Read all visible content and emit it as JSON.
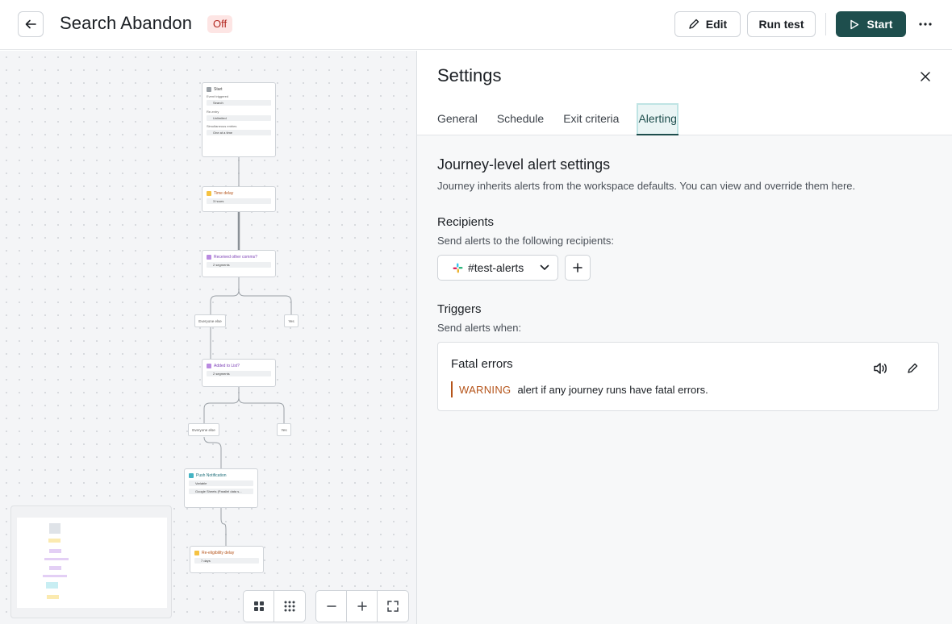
{
  "header": {
    "title": "Search Abandon",
    "status": "Off",
    "edit_label": "Edit",
    "run_test_label": "Run test",
    "start_label": "Start"
  },
  "canvas": {
    "start_node": {
      "title": "Start",
      "event_label": "Event triggered",
      "event_value": "Search",
      "reentry_label": "Re-entry",
      "reentry_value": "Unlimited",
      "simul_label": "Simultaneous entries",
      "simul_value": "One at a time"
    },
    "time_delay": {
      "title": "Time delay",
      "value": "3 hours"
    },
    "received": {
      "title": "Received other comms?",
      "value": "2 segments"
    },
    "branch1_else": "Everyone else",
    "branch1_yes": "Yes",
    "added_list": {
      "title": "Added to List?",
      "value": "2 segments"
    },
    "branch2_else": "Everyone else",
    "branch2_yes": "Yes",
    "push": {
      "title": "Push Notification",
      "line1": "Variable",
      "line2": "Google Sheets (Parallel data s..."
    },
    "reelig": {
      "title": "Re-eligibility delay",
      "value": "7 days"
    }
  },
  "panel": {
    "title": "Settings",
    "tabs": [
      "General",
      "Schedule",
      "Exit criteria",
      "Alerting"
    ],
    "active_tab": "Alerting",
    "section_title": "Journey-level alert settings",
    "section_desc": "Journey inherits alerts from the workspace defaults. You can view and override them here.",
    "recipients_title": "Recipients",
    "recipients_desc": "Send alerts to the following recipients:",
    "recipient_value": "#test-alerts",
    "triggers_title": "Triggers",
    "triggers_desc": "Send alerts when:",
    "trigger": {
      "title": "Fatal errors",
      "level": "WARNING",
      "text": "alert if any journey runs have fatal errors."
    }
  },
  "colors": {
    "primary": "#1e4e4d",
    "warning": "#b5541a",
    "badge_bg": "#fde5e4",
    "badge_text": "#b3261e"
  },
  "icons": [
    "arrow-left-icon",
    "pencil-icon",
    "play-icon",
    "more-horizontal-icon",
    "close-icon",
    "slack-icon",
    "chevron-down-icon",
    "plus-icon",
    "volume-icon",
    "edit-icon",
    "grid-icon",
    "dots-grid-icon",
    "minus-icon",
    "fullscreen-icon"
  ]
}
